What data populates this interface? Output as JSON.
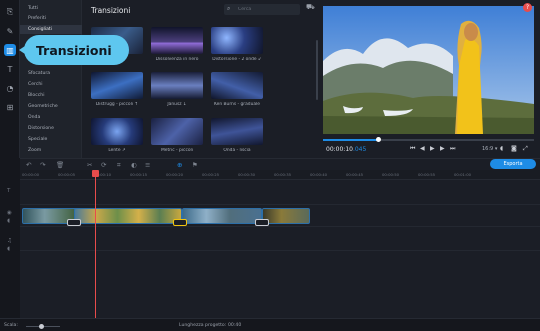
{
  "sidebar": {
    "categories": [
      {
        "label": "Tutti"
      },
      {
        "label": "Preferiti"
      },
      {
        "label": "Consigliati"
      },
      {
        "label": "Sfocatura"
      },
      {
        "label": "Cerchi"
      },
      {
        "label": "Blocchi"
      },
      {
        "label": "Geometriche"
      },
      {
        "label": "Onda"
      },
      {
        "label": "Distorsione"
      },
      {
        "label": "Speciale"
      },
      {
        "label": "Zoom"
      }
    ],
    "selected": "Consigliati",
    "tooltip": "Transizioni"
  },
  "transitions": {
    "title": "Transizioni",
    "search_placeholder": "Cerca",
    "items": [
      {
        "label": ""
      },
      {
        "label": "Dissolvenza in nero"
      },
      {
        "label": "Distorsione - 2 onde ↙"
      },
      {
        "label": "Distrugg - piccoli ↑"
      },
      {
        "label": "Janusz ↓"
      },
      {
        "label": "Ken Burns - graduale"
      },
      {
        "label": "Lente ↗"
      },
      {
        "label": "Metric - piccoli"
      },
      {
        "label": "Onda - liscia"
      }
    ]
  },
  "player": {
    "timecode": "00:00:10",
    "timecode_ms": ".045",
    "progress": 0.26,
    "aspect": "16:9 ▾"
  },
  "toolbar": {
    "export_label": "Esporta"
  },
  "timeline": {
    "ruler": [
      "00:00:00",
      "00:00:05",
      "00:00:10",
      "00:00:15",
      "00:00:20",
      "00:00:25",
      "00:00:30",
      "00:00:35",
      "00:00:40",
      "00:00:45",
      "00:00:50",
      "00:00:55",
      "00:01:00"
    ]
  },
  "status": {
    "scale_label": "Scala:",
    "zoom": 0.45,
    "duration_label": "Lunghezza progetto:",
    "duration_value": "00:40"
  },
  "colors": {
    "accent": "#1e8ce6",
    "tooltip": "#5ec7ef",
    "playhead": "#e74c4c"
  }
}
